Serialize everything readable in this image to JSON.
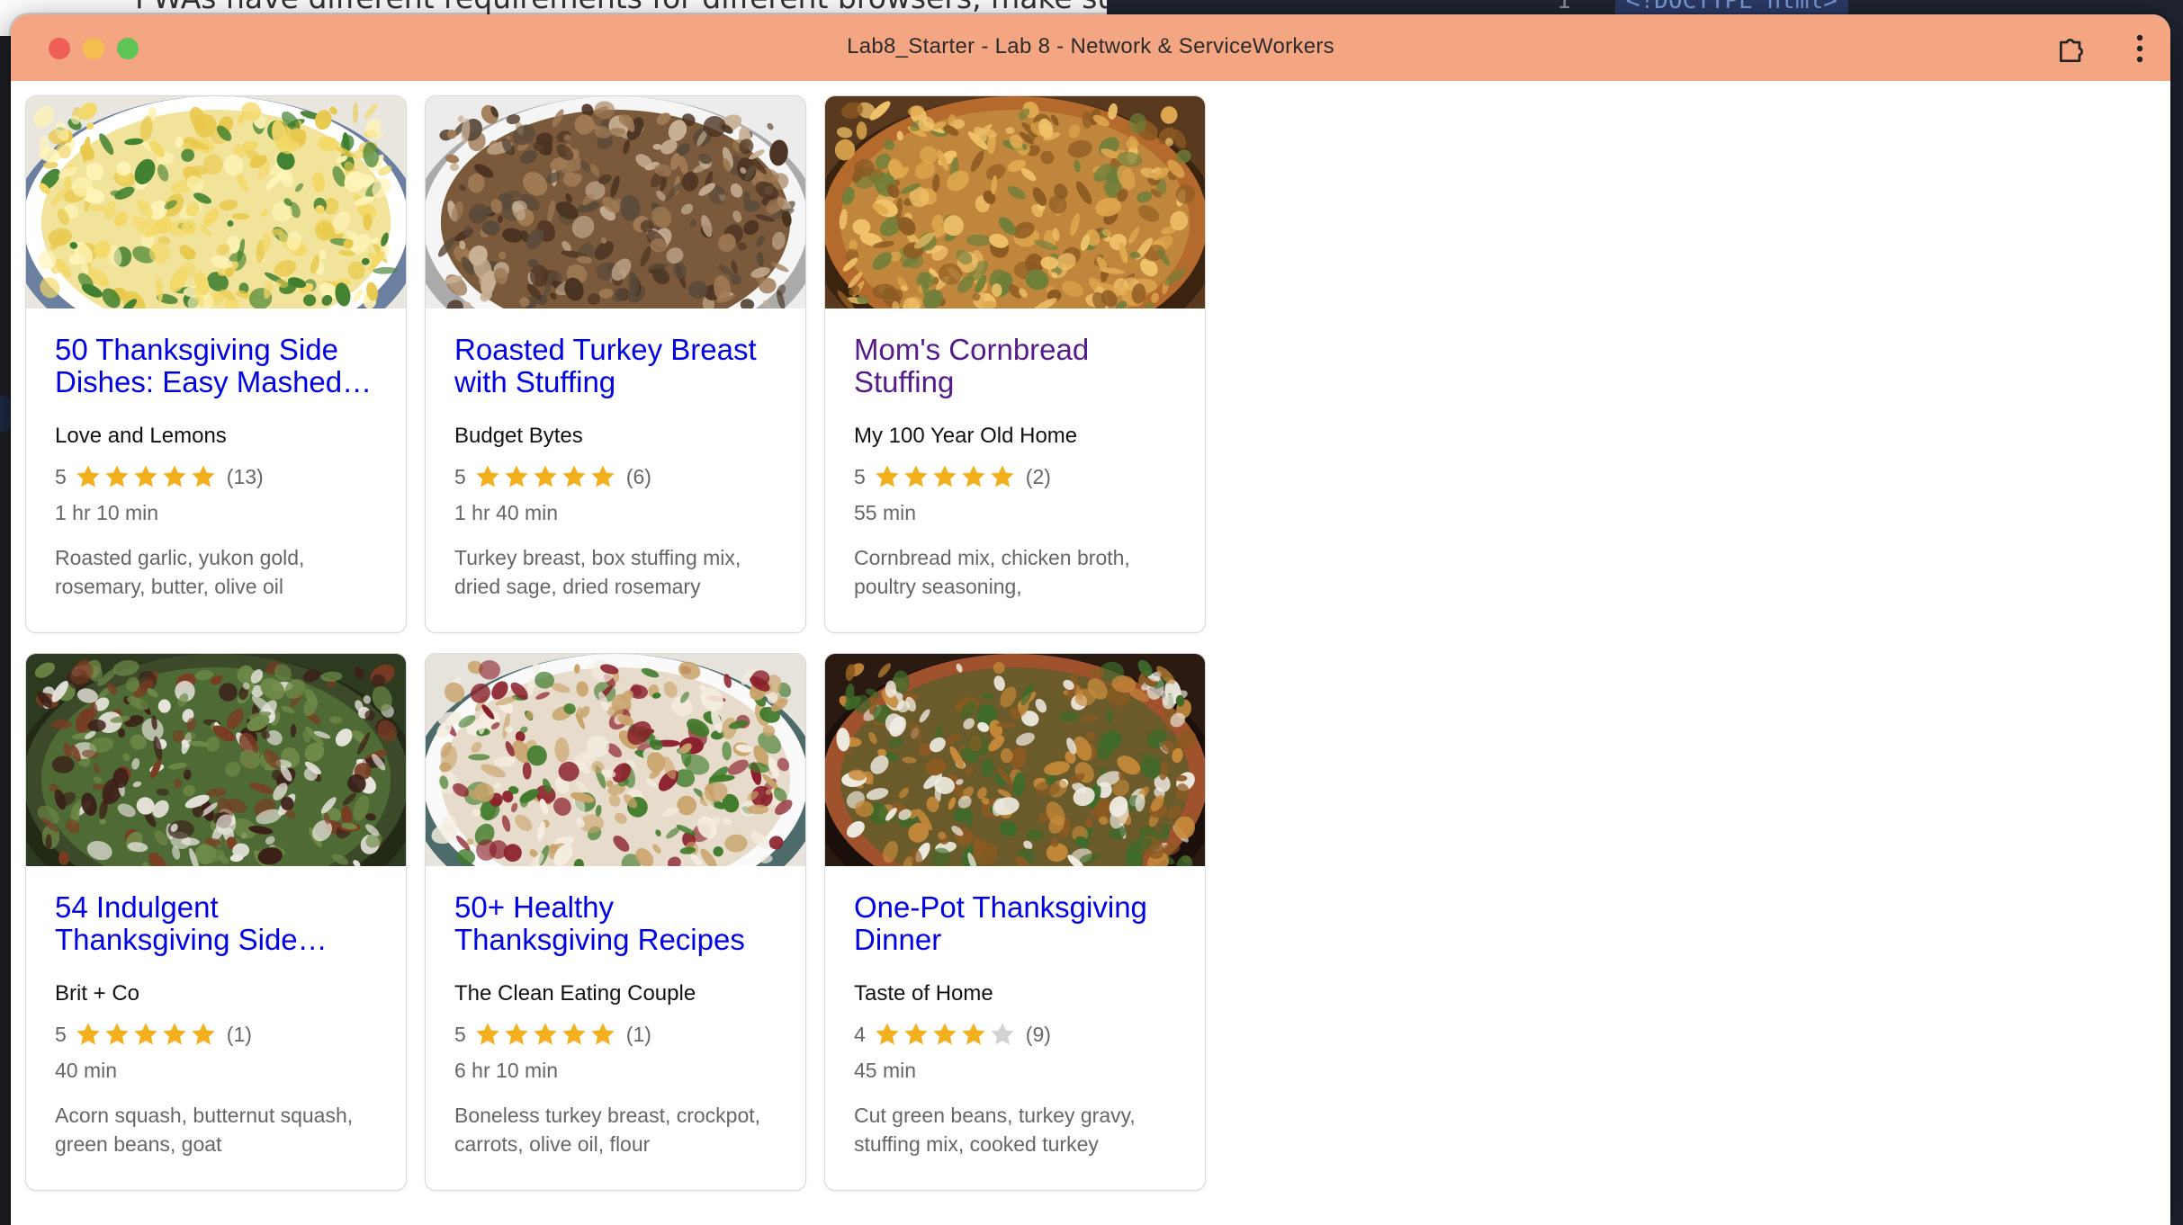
{
  "background": {
    "doc_text": "PWAs have different requirements for different browsers, make sure",
    "editor_line_number": "1",
    "editor_code": "<!DOCTYPE html>"
  },
  "window": {
    "title": "Lab8_Starter - Lab 8 - Network & ServiceWorkers"
  },
  "colors": {
    "titlebar": "#f4a582",
    "link": "#0000e6",
    "visited_link": "#551a8b",
    "star_filled": "#f2b01e",
    "star_empty": "#d3d3d3"
  },
  "icons": {
    "window_close": "close-traffic-light",
    "window_minimize": "minimize-traffic-light",
    "window_maximize": "maximize-traffic-light",
    "extensions": "puzzle-icon",
    "menu": "kebab-menu-icon"
  },
  "recipes": [
    {
      "title": "50 Thanksgiving Side Dishes: Easy Mashed…",
      "visited": false,
      "image": "mashed-potatoes",
      "source": "Love and Lemons",
      "rating": "5",
      "rating_value": 5,
      "reviews": "(13)",
      "time": "1 hr 10 min",
      "ingredients": "Roasted garlic, yukon gold, rosemary, butter, olive oil"
    },
    {
      "title": "Roasted Turkey Breast with Stuffing",
      "visited": false,
      "image": "turkey-breast-with-stuffing",
      "source": "Budget Bytes",
      "rating": "5",
      "rating_value": 5,
      "reviews": "(6)",
      "time": "1 hr 40 min",
      "ingredients": "Turkey breast, box stuffing mix, dried sage, dried rosemary"
    },
    {
      "title": "Mom's Cornbread Stuffing",
      "visited": true,
      "image": "cornbread-stuffing",
      "source": "My 100 Year Old Home",
      "rating": "5",
      "rating_value": 5,
      "reviews": "(2)",
      "time": "55 min",
      "ingredients": "Cornbread mix, chicken broth, poultry seasoning,"
    },
    {
      "title": "54 Indulgent Thanksgiving Side…",
      "visited": false,
      "image": "green-beans-with-pecans",
      "source": "Brit + Co",
      "rating": "5",
      "rating_value": 5,
      "reviews": "(1)",
      "time": "40 min",
      "ingredients": "Acorn squash, butternut squash, green beans, goat"
    },
    {
      "title": "50+ Healthy Thanksgiving Recipes",
      "visited": false,
      "image": "turkey-plate-with-green-beans",
      "source": "The Clean Eating Couple",
      "rating": "5",
      "rating_value": 5,
      "reviews": "(1)",
      "time": "6 hr 10 min",
      "ingredients": "Boneless turkey breast, crockpot, carrots, olive oil, flour"
    },
    {
      "title": "One-Pot Thanksgiving Dinner",
      "visited": false,
      "image": "one-pot-dinner",
      "source": "Taste of Home",
      "rating": "4",
      "rating_value": 4,
      "reviews": "(9)",
      "time": "45 min",
      "ingredients": "Cut green beans, turkey gravy, stuffing mix, cooked turkey"
    }
  ]
}
